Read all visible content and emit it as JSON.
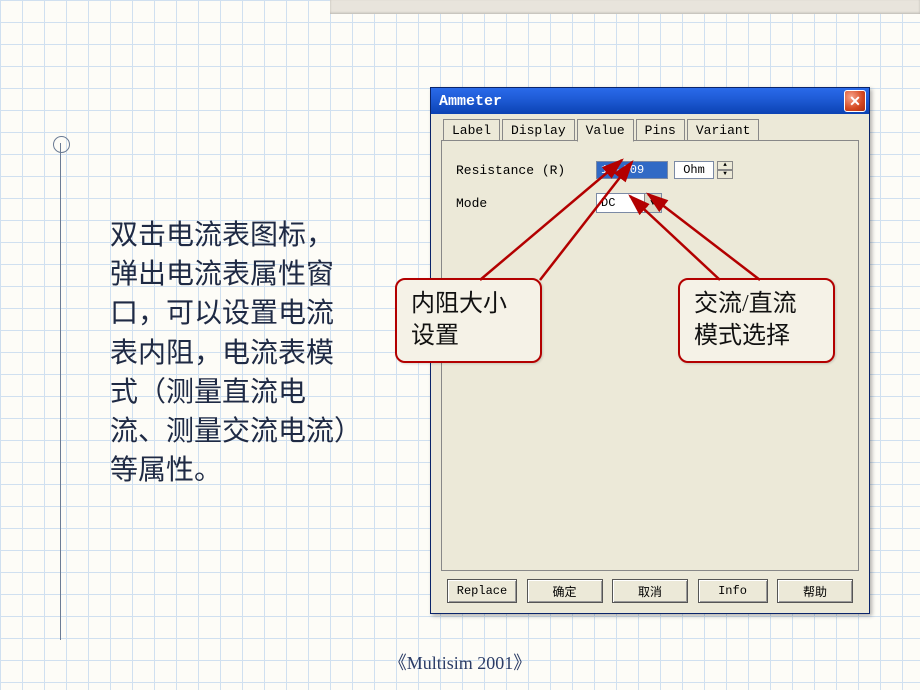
{
  "slide": {
    "body_text": "双击电流表图标，弹出电流表属性窗口，可以设置电流表内阻，电流表模式（测量直流电流、测量交流电流）等属性。",
    "footer": "《Multisim 2001》"
  },
  "dialog": {
    "title": "Ammeter",
    "tabs": [
      "Label",
      "Display",
      "Value",
      "Pins",
      "Variant"
    ],
    "active_tab": "Value",
    "fields": {
      "resistance": {
        "label": "Resistance (R)",
        "value": "1e-009",
        "unit": "Ohm"
      },
      "mode": {
        "label": "Mode",
        "value": "DC"
      }
    },
    "buttons": {
      "replace": "Replace",
      "ok": "确定",
      "cancel": "取消",
      "info": "Info",
      "help": "帮助"
    }
  },
  "callouts": {
    "c1_l1": "内阻大小",
    "c1_l2": "设置",
    "c2_l1": "交流/直流",
    "c2_l2": "模式选择"
  }
}
